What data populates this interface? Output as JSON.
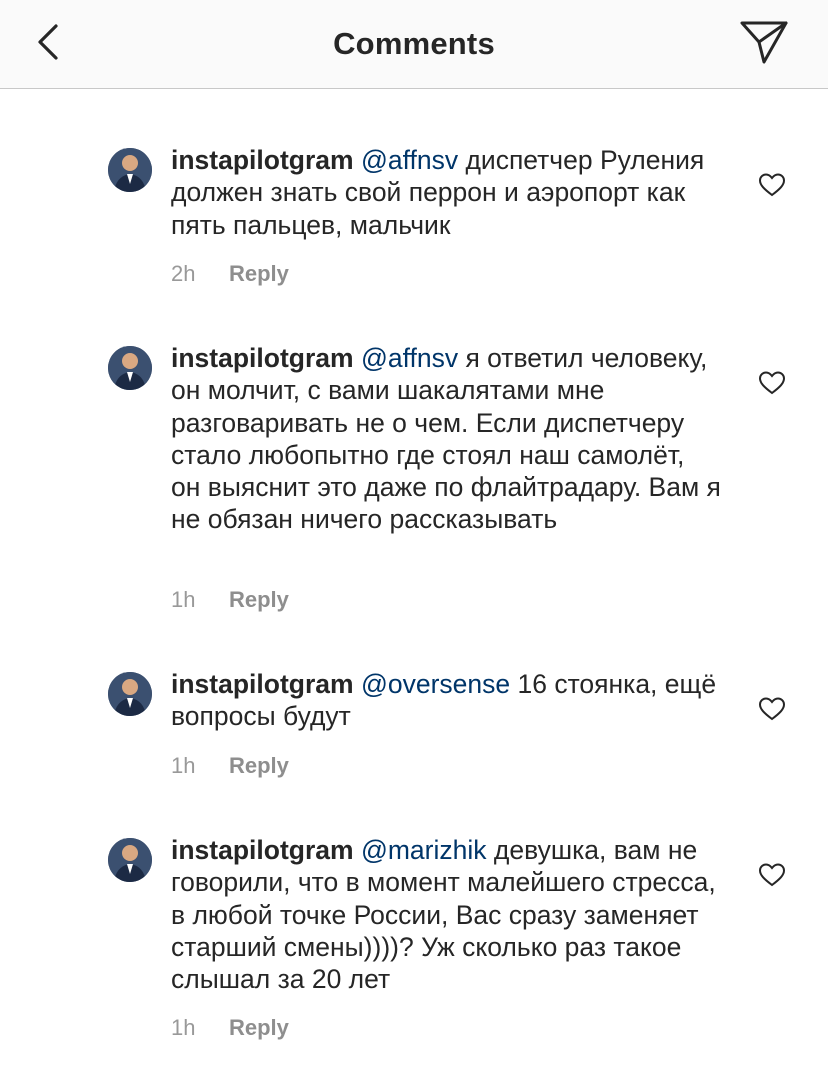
{
  "header": {
    "title": "Comments",
    "back_icon": "chevron-left-icon",
    "share_icon": "paper-plane-icon"
  },
  "colors": {
    "mention": "#003569",
    "meta": "#999999",
    "text": "#262626"
  },
  "comments": [
    {
      "username": "instapilotgram",
      "mention": "@affnsv",
      "text": " диспетчер Руления должен знать свой перрон и аэропорт как пять пальцев, мальчик",
      "time": "2h",
      "reply_label": "Reply"
    },
    {
      "username": "instapilotgram",
      "mention": "@affnsv",
      "text": " я ответил человеку, он молчит, с вами шакалятами мне разговаривать не о чем. Если диспетчеру стало любопытно где стоял наш самолёт, он выяснит это даже по флайтрадару. Вам я не обязан ничего рассказывать",
      "time": "1h",
      "reply_label": "Reply"
    },
    {
      "username": "instapilotgram",
      "mention": "@oversense",
      "text": " 16 стоянка, ещё вопросы будут",
      "time": "1h",
      "reply_label": "Reply"
    },
    {
      "username": "instapilotgram",
      "mention": "@marizhik",
      "text": " девушка, вам не говорили, что в момент малейшего стресса, в любой точке России, Вас сразу заменяет старший смены))))? Уж сколько раз такое слышал за 20 лет",
      "time": "1h",
      "reply_label": "Reply"
    }
  ]
}
